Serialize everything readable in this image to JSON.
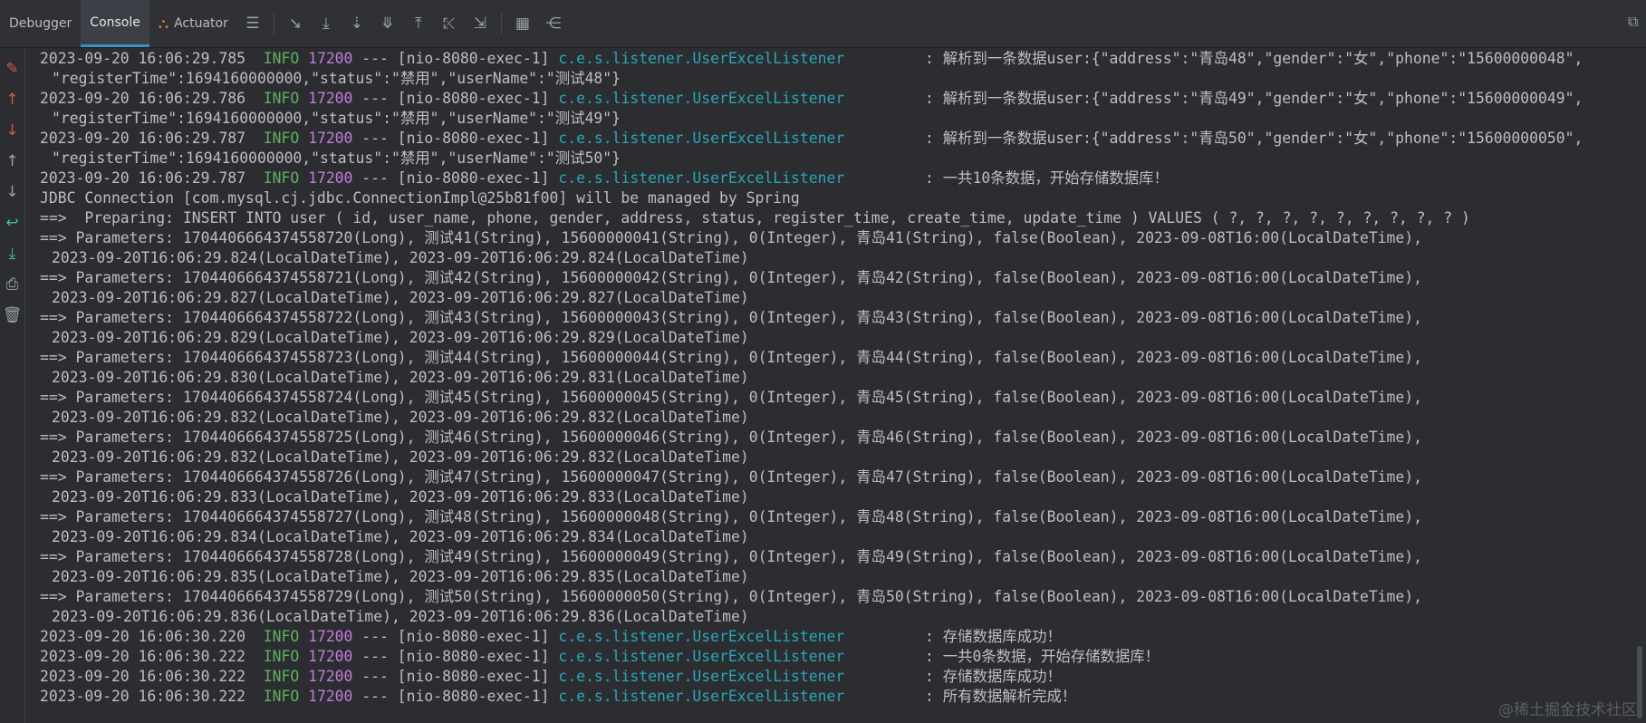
{
  "tabs": [
    {
      "label": "Debugger"
    },
    {
      "label": "Console"
    },
    {
      "label": "Actuator"
    }
  ],
  "colors": {
    "level": "#5fb15f",
    "pid": "#c57bdb",
    "logger": "#2aa6b8",
    "text": "#bcbec4",
    "background": "#2b2d31"
  },
  "log_lines": [
    {
      "ts": "2023-09-20 16:06:29.785",
      "level": "INFO",
      "pid": "17200",
      "thread": "--- [nio-8080-exec-1]",
      "logger": "c.e.s.listener.UserExcelListener",
      "msg": "         : 解析到一条数据user:{\"address\":\"青岛48\",\"gender\":\"女\",\"phone\":\"15600000048\","
    },
    {
      "text": "\"registerTime\":1694160000000,\"status\":\"禁用\",\"userName\":\"测试48\"}"
    },
    {
      "ts": "2023-09-20 16:06:29.786",
      "level": "INFO",
      "pid": "17200",
      "thread": "--- [nio-8080-exec-1]",
      "logger": "c.e.s.listener.UserExcelListener",
      "msg": "         : 解析到一条数据user:{\"address\":\"青岛49\",\"gender\":\"女\",\"phone\":\"15600000049\","
    },
    {
      "text": "\"registerTime\":1694160000000,\"status\":\"禁用\",\"userName\":\"测试49\"}"
    },
    {
      "ts": "2023-09-20 16:06:29.787",
      "level": "INFO",
      "pid": "17200",
      "thread": "--- [nio-8080-exec-1]",
      "logger": "c.e.s.listener.UserExcelListener",
      "msg": "         : 解析到一条数据user:{\"address\":\"青岛50\",\"gender\":\"女\",\"phone\":\"15600000050\","
    },
    {
      "text": "\"registerTime\":1694160000000,\"status\":\"禁用\",\"userName\":\"测试50\"}"
    },
    {
      "ts": "2023-09-20 16:06:29.787",
      "level": "INFO",
      "pid": "17200",
      "thread": "--- [nio-8080-exec-1]",
      "logger": "c.e.s.listener.UserExcelListener",
      "msg": "         : 一共10条数据，开始存储数据库！"
    },
    {
      "plain": "JDBC Connection [com.mysql.cj.jdbc.ConnectionImpl@25b81f00] will be managed by Spring"
    },
    {
      "plain": "==>  Preparing: INSERT INTO user ( id, user_name, phone, gender, address, status, register_time, create_time, update_time ) VALUES ( ?, ?, ?, ?, ?, ?, ?, ?, ? )"
    },
    {
      "plain": "==> Parameters: 1704406664374558720(Long), 测试41(String), 15600000041(String), 0(Integer), 青岛41(String), false(Boolean), 2023-09-08T16:00(LocalDateTime),"
    },
    {
      "text": "2023-09-20T16:06:29.824(LocalDateTime), 2023-09-20T16:06:29.824(LocalDateTime)"
    },
    {
      "plain": "==> Parameters: 1704406664374558721(Long), 测试42(String), 15600000042(String), 0(Integer), 青岛42(String), false(Boolean), 2023-09-08T16:00(LocalDateTime),"
    },
    {
      "text": "2023-09-20T16:06:29.827(LocalDateTime), 2023-09-20T16:06:29.827(LocalDateTime)"
    },
    {
      "plain": "==> Parameters: 1704406664374558722(Long), 测试43(String), 15600000043(String), 0(Integer), 青岛43(String), false(Boolean), 2023-09-08T16:00(LocalDateTime),"
    },
    {
      "text": "2023-09-20T16:06:29.829(LocalDateTime), 2023-09-20T16:06:29.829(LocalDateTime)"
    },
    {
      "plain": "==> Parameters: 1704406664374558723(Long), 测试44(String), 15600000044(String), 0(Integer), 青岛44(String), false(Boolean), 2023-09-08T16:00(LocalDateTime),"
    },
    {
      "text": "2023-09-20T16:06:29.830(LocalDateTime), 2023-09-20T16:06:29.831(LocalDateTime)"
    },
    {
      "plain": "==> Parameters: 1704406664374558724(Long), 测试45(String), 15600000045(String), 0(Integer), 青岛45(String), false(Boolean), 2023-09-08T16:00(LocalDateTime),"
    },
    {
      "text": "2023-09-20T16:06:29.832(LocalDateTime), 2023-09-20T16:06:29.832(LocalDateTime)"
    },
    {
      "plain": "==> Parameters: 1704406664374558725(Long), 测试46(String), 15600000046(String), 0(Integer), 青岛46(String), false(Boolean), 2023-09-08T16:00(LocalDateTime),"
    },
    {
      "text": "2023-09-20T16:06:29.832(LocalDateTime), 2023-09-20T16:06:29.832(LocalDateTime)"
    },
    {
      "plain": "==> Parameters: 1704406664374558726(Long), 测试47(String), 15600000047(String), 0(Integer), 青岛47(String), false(Boolean), 2023-09-08T16:00(LocalDateTime),"
    },
    {
      "text": "2023-09-20T16:06:29.833(LocalDateTime), 2023-09-20T16:06:29.833(LocalDateTime)"
    },
    {
      "plain": "==> Parameters: 1704406664374558727(Long), 测试48(String), 15600000048(String), 0(Integer), 青岛48(String), false(Boolean), 2023-09-08T16:00(LocalDateTime),"
    },
    {
      "text": "2023-09-20T16:06:29.834(LocalDateTime), 2023-09-20T16:06:29.834(LocalDateTime)"
    },
    {
      "plain": "==> Parameters: 1704406664374558728(Long), 测试49(String), 15600000049(String), 0(Integer), 青岛49(String), false(Boolean), 2023-09-08T16:00(LocalDateTime),"
    },
    {
      "text": "2023-09-20T16:06:29.835(LocalDateTime), 2023-09-20T16:06:29.835(LocalDateTime)"
    },
    {
      "plain": "==> Parameters: 1704406664374558729(Long), 测试50(String), 15600000050(String), 0(Integer), 青岛50(String), false(Boolean), 2023-09-08T16:00(LocalDateTime),"
    },
    {
      "text": "2023-09-20T16:06:29.836(LocalDateTime), 2023-09-20T16:06:29.836(LocalDateTime)"
    },
    {
      "ts": "2023-09-20 16:06:30.220",
      "level": "INFO",
      "pid": "17200",
      "thread": "--- [nio-8080-exec-1]",
      "logger": "c.e.s.listener.UserExcelListener",
      "msg": "         : 存储数据库成功！"
    },
    {
      "ts": "2023-09-20 16:06:30.222",
      "level": "INFO",
      "pid": "17200",
      "thread": "--- [nio-8080-exec-1]",
      "logger": "c.e.s.listener.UserExcelListener",
      "msg": "         : 一共0条数据，开始存储数据库！"
    },
    {
      "ts": "2023-09-20 16:06:30.222",
      "level": "INFO",
      "pid": "17200",
      "thread": "--- [nio-8080-exec-1]",
      "logger": "c.e.s.listener.UserExcelListener",
      "msg": "         : 存储数据库成功！"
    },
    {
      "ts": "2023-09-20 16:06:30.222",
      "level": "INFO",
      "pid": "17200",
      "thread": "--- [nio-8080-exec-1]",
      "logger": "c.e.s.listener.UserExcelListener",
      "msg": "         : 所有数据解析完成！"
    }
  ],
  "watermark": "@稀土掘金技术社区"
}
